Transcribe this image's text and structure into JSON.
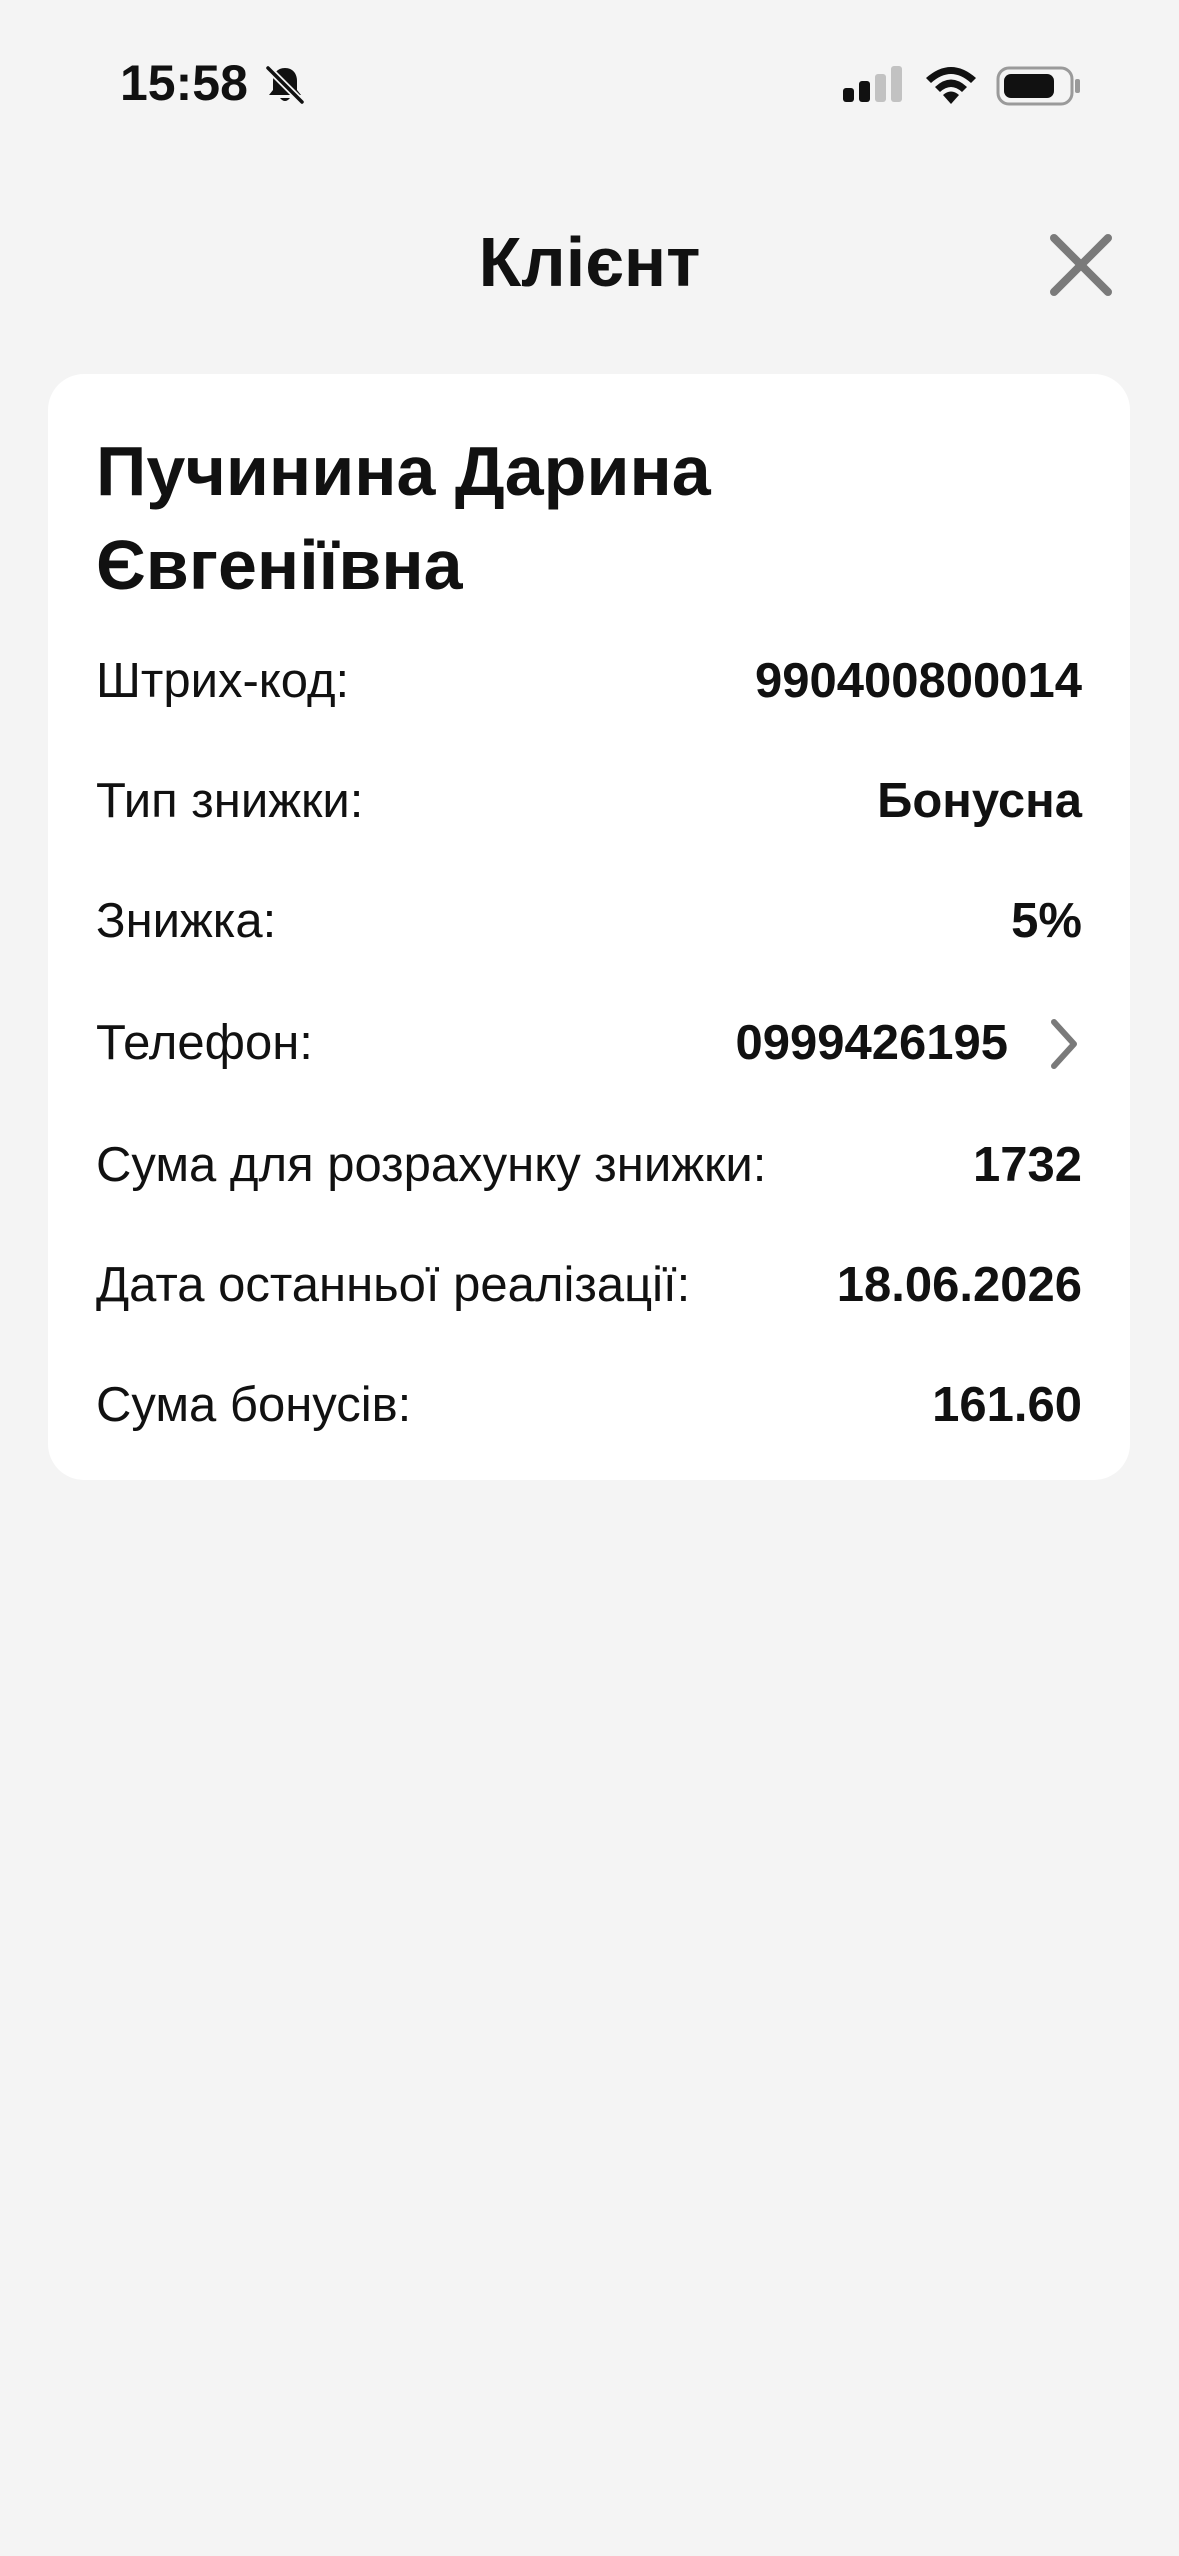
{
  "status_bar": {
    "time": "15:58",
    "icons": [
      "bell-slash-icon",
      "cellular-signal-icon",
      "wifi-icon",
      "battery-icon"
    ]
  },
  "header": {
    "title": "Клієнт",
    "close_icon": "close-icon"
  },
  "client": {
    "name": "Пучинина Дарина Євгеніївна",
    "rows": [
      {
        "label": "Штрих-код:",
        "value": "990400800014"
      },
      {
        "label": "Тип знижки:",
        "value": "Бонусна"
      },
      {
        "label": "Знижка:",
        "value": "5%"
      },
      {
        "label": "Телефон:",
        "value": "0999426195",
        "icon": "chevron-right-icon"
      },
      {
        "label": "Сума для розрахунку знижки:",
        "value": "1732"
      },
      {
        "label": "Дата останньої реалізації:",
        "value": "18.06.2026"
      },
      {
        "label": "Сума бонусів:",
        "value": "161.60"
      }
    ]
  },
  "colors": {
    "background": "#f4f4f4",
    "card": "#ffffff",
    "text": "#111111",
    "icon_gray": "#7a7a7a"
  }
}
